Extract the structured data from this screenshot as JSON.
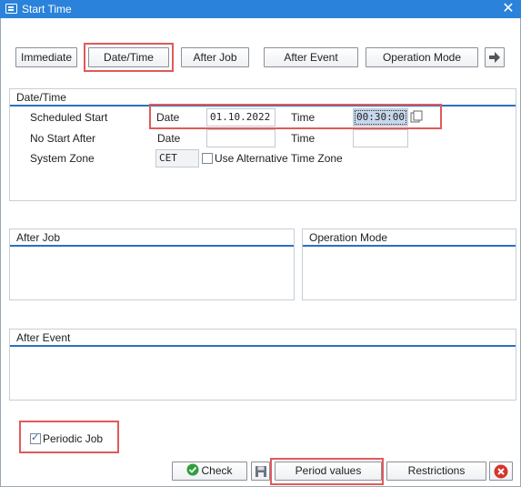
{
  "window": {
    "title": "Start Time",
    "close_icon": "close-icon"
  },
  "start_buttons": {
    "immediate": "Immediate",
    "date_time": "Date/Time",
    "after_job": "After Job",
    "after_event": "After Event",
    "operation_mode": "Operation Mode",
    "more_icon": "arrow-right-icon"
  },
  "datetime_group": {
    "title": "Date/Time",
    "scheduled_start": {
      "label": "Scheduled Start",
      "date_label": "Date",
      "date_value": "01.10.2022",
      "time_label": "Time",
      "time_value": "00:30:00"
    },
    "no_start_after": {
      "label": "No Start After",
      "date_label": "Date",
      "date_value": "",
      "time_label": "Time",
      "time_value": ""
    },
    "system_zone": {
      "label": "System Zone",
      "value": "CET",
      "alt_tz_label": "Use Alternative Time Zone",
      "alt_tz_checked": false
    }
  },
  "after_job_group": {
    "title": "After Job"
  },
  "operation_mode_group": {
    "title": "Operation Mode"
  },
  "after_event_group": {
    "title": "After Event"
  },
  "periodic_job": {
    "label": "Periodic Job",
    "checked": true
  },
  "footer": {
    "check": "Check",
    "period_values": "Period values",
    "restrictions": "Restrictions",
    "save_icon": "save-icon",
    "cancel_icon": "cancel-icon"
  },
  "colors": {
    "title_bar": "#2a82da",
    "highlight": "#e05a5a",
    "group_line": "#2b6fc2",
    "check_green": "#2e9e3e",
    "cancel_red": "#d6342b"
  }
}
